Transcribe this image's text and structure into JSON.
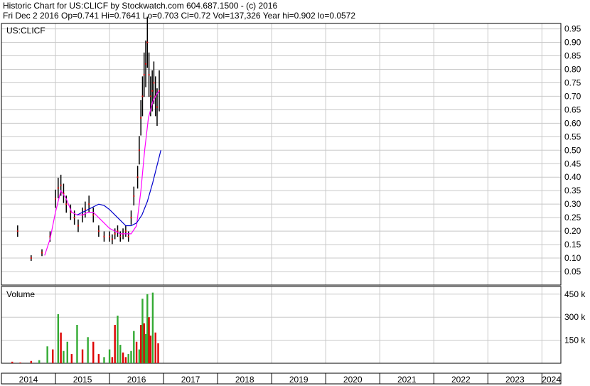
{
  "header": {
    "line1": "Historic Chart for US:CLICF by Stockwatch.com 604.687.1500 - (c) 2016",
    "line2": "Fri Dec  2 2016  Op=0.741  Hi=0.7641  Lo=0.703  Cl=0.72  Vol=137,326  Year hi=0.902  lo=0.0572"
  },
  "colors": {
    "price": "#000000",
    "price_marker": "#cc0000",
    "ma_short": "#ff00ff",
    "ma_long": "#0000cc",
    "volume_up": "#33aa33",
    "volume_down": "#dd0000",
    "grid": "#c8c8c8"
  },
  "chart_data": [
    {
      "type": "line",
      "title": "US:CLICF",
      "ylim": [
        0,
        0.97
      ],
      "yticks": [
        "0.95",
        "0.90",
        "0.85",
        "0.80",
        "0.75",
        "0.70",
        "0.65",
        "0.60",
        "0.55",
        "0.50",
        "0.45",
        "0.40",
        "0.35",
        "0.30",
        "0.25",
        "0.20",
        "0.15",
        "0.10",
        "0.05"
      ],
      "x_years": [
        "2014",
        "2015",
        "2016",
        "2017",
        "2018",
        "2019",
        "2020",
        "2021",
        "2022",
        "2023",
        "2024"
      ],
      "grid": true,
      "series": [
        {
          "key": "price",
          "x": [
            2014.3,
            2014.55,
            2014.75,
            2014.9,
            2015.0,
            2015.05,
            2015.1,
            2015.15,
            2015.2,
            2015.28,
            2015.35,
            2015.42,
            2015.5,
            2015.55,
            2015.62,
            2015.7,
            2015.8,
            2015.9,
            2016.0,
            2016.05,
            2016.1,
            2016.15,
            2016.2,
            2016.25,
            2016.3,
            2016.35,
            2016.4,
            2016.45,
            2016.52,
            2016.55,
            2016.58,
            2016.61,
            2016.64,
            2016.67,
            2016.7,
            2016.73,
            2016.76,
            2016.79,
            2016.82,
            2016.85,
            2016.88,
            2016.92
          ],
          "y": [
            0.2,
            0.1,
            0.12,
            0.18,
            0.32,
            0.36,
            0.37,
            0.34,
            0.3,
            0.27,
            0.25,
            0.22,
            0.26,
            0.28,
            0.3,
            0.26,
            0.2,
            0.18,
            0.18,
            0.17,
            0.19,
            0.2,
            0.18,
            0.19,
            0.2,
            0.18,
            0.25,
            0.33,
            0.4,
            0.5,
            0.62,
            0.7,
            0.78,
            0.82,
            0.9,
            0.78,
            0.7,
            0.72,
            0.75,
            0.7,
            0.66,
            0.72
          ]
        },
        {
          "key": "ma_short",
          "x": [
            2014.8,
            2014.9,
            2015.0,
            2015.1,
            2015.2,
            2015.3,
            2015.4,
            2015.5,
            2015.6,
            2015.7,
            2015.8,
            2015.9,
            2016.0,
            2016.1,
            2016.2,
            2016.3,
            2016.4,
            2016.5,
            2016.58,
            2016.65,
            2016.72,
            2016.8,
            2016.88,
            2016.92
          ],
          "y": [
            0.11,
            0.17,
            0.27,
            0.35,
            0.32,
            0.27,
            0.26,
            0.26,
            0.27,
            0.27,
            0.25,
            0.23,
            0.21,
            0.2,
            0.19,
            0.19,
            0.19,
            0.22,
            0.35,
            0.5,
            0.62,
            0.68,
            0.71,
            0.72
          ]
        },
        {
          "key": "ma_long",
          "x": [
            2015.4,
            2015.5,
            2015.6,
            2015.7,
            2015.8,
            2015.9,
            2016.0,
            2016.1,
            2016.2,
            2016.3,
            2016.4,
            2016.5,
            2016.6,
            2016.7,
            2016.8,
            2016.9,
            2016.95
          ],
          "y": [
            0.26,
            0.27,
            0.28,
            0.29,
            0.3,
            0.295,
            0.28,
            0.26,
            0.24,
            0.22,
            0.22,
            0.23,
            0.26,
            0.31,
            0.38,
            0.46,
            0.5
          ]
        }
      ]
    },
    {
      "type": "bar",
      "title": "Volume",
      "ylim": [
        0,
        500
      ],
      "yticks": [
        "450 k",
        "300 k",
        "150 k"
      ],
      "series": [
        {
          "key": "volume",
          "x": [
            2014.2,
            2014.35,
            2014.55,
            2014.7,
            2014.85,
            2014.95,
            2015.05,
            2015.1,
            2015.15,
            2015.22,
            2015.3,
            2015.4,
            2015.5,
            2015.6,
            2015.7,
            2015.8,
            2015.9,
            2016.0,
            2016.05,
            2016.1,
            2016.15,
            2016.2,
            2016.25,
            2016.3,
            2016.35,
            2016.4,
            2016.45,
            2016.5,
            2016.55,
            2016.58,
            2016.61,
            2016.64,
            2016.67,
            2016.7,
            2016.73,
            2016.76,
            2016.8,
            2016.85,
            2016.9
          ],
          "values": [
            10,
            5,
            15,
            20,
            110,
            90,
            320,
            200,
            80,
            140,
            60,
            250,
            90,
            170,
            140,
            60,
            40,
            90,
            40,
            250,
            310,
            120,
            70,
            40,
            60,
            80,
            210,
            140,
            90,
            250,
            420,
            260,
            190,
            450,
            300,
            180,
            460,
            200,
            130
          ],
          "direction": [
            "down",
            "down",
            "down",
            "up",
            "up",
            "down",
            "up",
            "down",
            "up",
            "up",
            "down",
            "up",
            "down",
            "up",
            "down",
            "down",
            "up",
            "up",
            "down",
            "down",
            "up",
            "up",
            "down",
            "down",
            "up",
            "up",
            "up",
            "down",
            "up",
            "down",
            "up",
            "down",
            "up",
            "up",
            "down",
            "down",
            "up",
            "down",
            "down"
          ]
        }
      ]
    }
  ]
}
